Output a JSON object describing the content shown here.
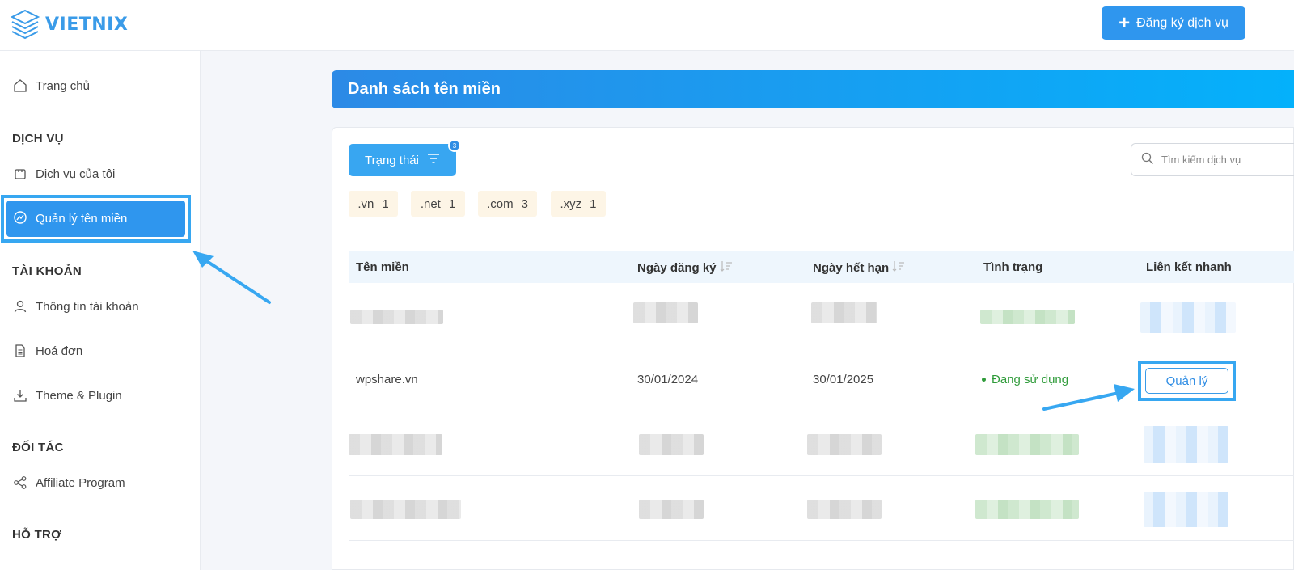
{
  "header": {
    "logo_text": "VIETNIX",
    "register_button": "Đăng ký dịch vụ"
  },
  "sidebar": {
    "home": "Trang chủ",
    "section_services": "DỊCH VỤ",
    "my_services": "Dịch vụ của tôi",
    "domain_manage": "Quản lý tên miền",
    "section_account": "TÀI KHOẢN",
    "account_info": "Thông tin tài khoản",
    "invoices": "Hoá đơn",
    "theme_plugin": "Theme & Plugin",
    "section_partner": "ĐỐI TÁC",
    "affiliate": "Affiliate Program",
    "section_support": "HỖ TRỢ"
  },
  "main": {
    "title": "Danh sách tên miền",
    "status_filter": "Trạng thái",
    "status_badge": "3",
    "search_placeholder": "Tìm kiếm dịch vụ",
    "tld_chips": [
      {
        "name": ".vn",
        "count": "1"
      },
      {
        "name": ".net",
        "count": "1"
      },
      {
        "name": ".com",
        "count": "3"
      },
      {
        "name": ".xyz",
        "count": "1"
      }
    ],
    "table": {
      "headers": [
        "Tên miền",
        "Ngày đăng ký",
        "Ngày hết hạn",
        "Tình trạng",
        "Liên kết nhanh"
      ],
      "visible_row": {
        "domain": "wpshare.vn",
        "registered": "30/01/2024",
        "expires": "30/01/2025",
        "status": "Đang sử dụng",
        "action": "Quản lý"
      }
    }
  },
  "colors": {
    "primary": "#2f96ee",
    "accent_highlight": "#37a7f1",
    "status_green": "#2f9b3a",
    "chip_bg": "#fdf5e6"
  }
}
